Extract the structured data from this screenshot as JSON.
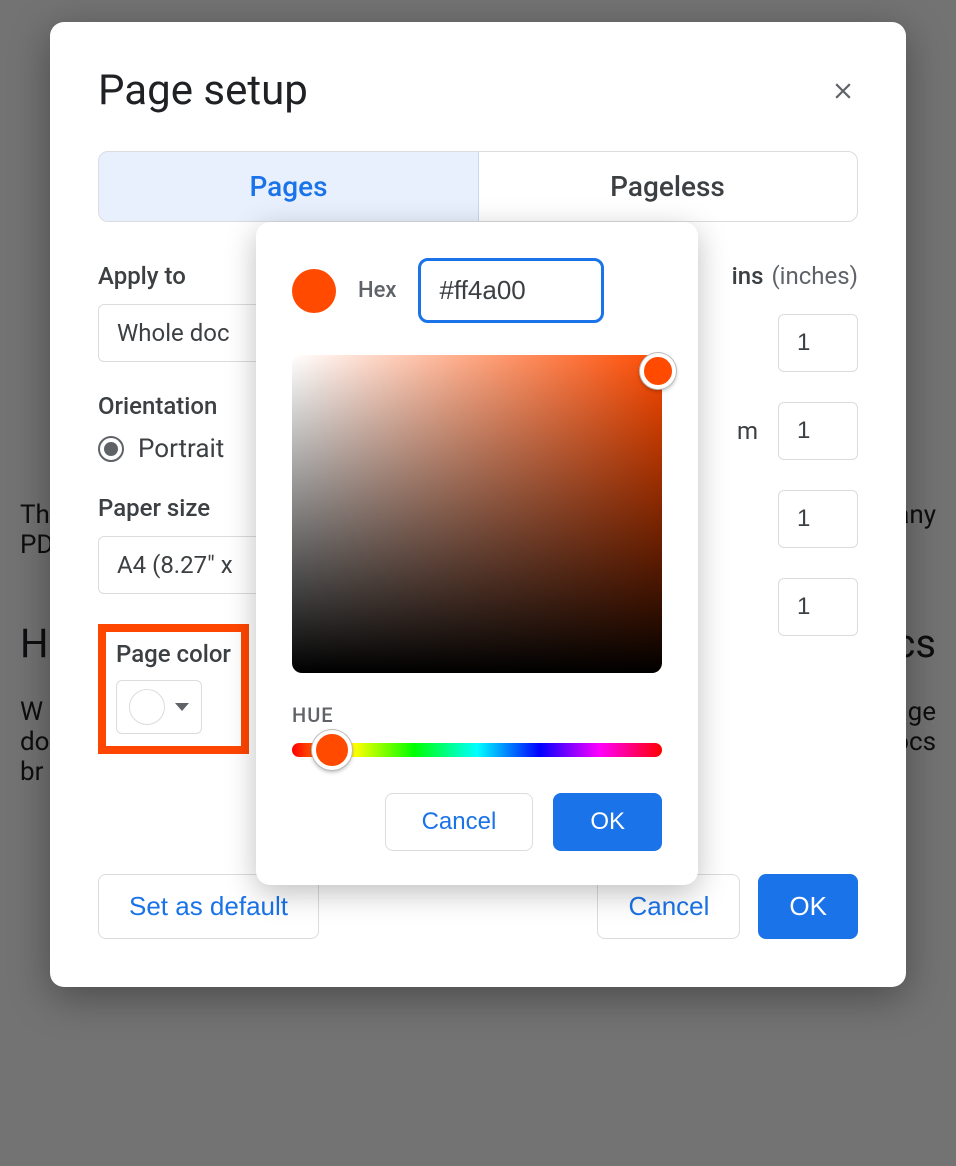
{
  "background": {
    "line1": "Th",
    "line1_right": "any",
    "line2": "PD",
    "heading": "H",
    "heading_right": "ocs",
    "para1": "W",
    "para1_right": "page",
    "para2": "do",
    "para2_right": "ocs",
    "para3": "br"
  },
  "modal": {
    "title": "Page setup",
    "tabs": {
      "pages": "Pages",
      "pageless": "Pageless"
    },
    "apply_to_label": "Apply to",
    "apply_to_value": "Whole doc",
    "orientation_label": "Orientation",
    "orientation_value": "Portrait",
    "paper_size_label": "Paper size",
    "paper_size_value": "A4 (8.27\" x",
    "page_color_label": "Page color",
    "margins_label": "ins",
    "margins_unit": "(inches)",
    "margin_bottom_label": "m",
    "margins": {
      "top": "1",
      "bottom": "1",
      "left": "1",
      "right": "1"
    },
    "set_default": "Set as default",
    "cancel": "Cancel",
    "ok": "OK"
  },
  "picker": {
    "hex_label": "Hex",
    "hex_value": "#ff4a00",
    "hue_label": "HUE",
    "cancel": "Cancel",
    "ok": "OK",
    "preview_color": "#ff4a00"
  }
}
